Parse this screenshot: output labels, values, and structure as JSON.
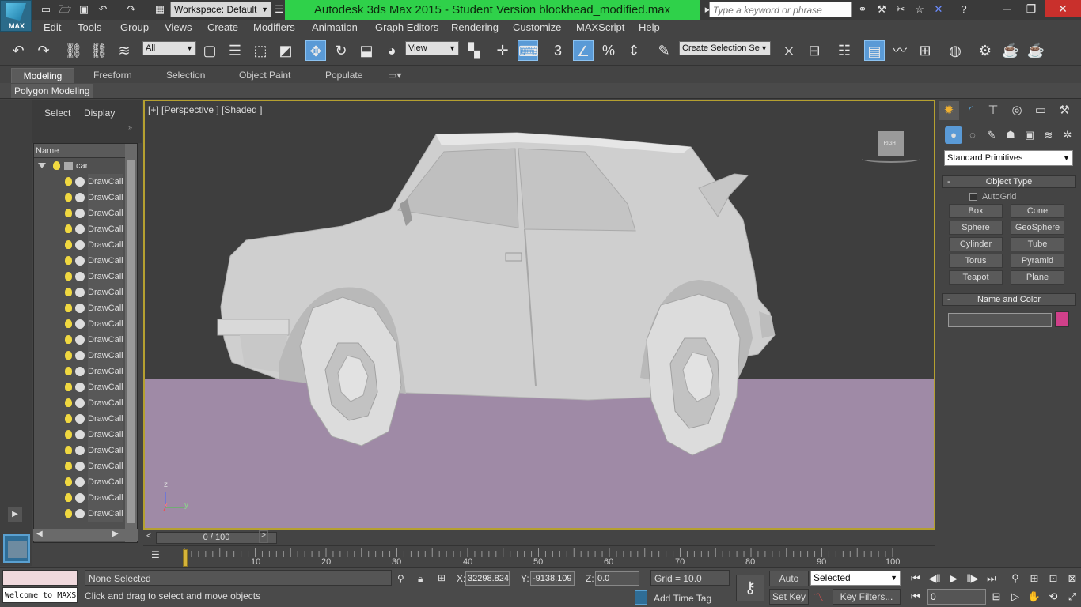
{
  "title_bar": {
    "logo_text": "MAX",
    "workspace": "Workspace: Default",
    "title": "Autodesk 3ds Max  2015   - Student Version     blockhead_modified.max",
    "search_placeholder": "Type a keyword or phrase"
  },
  "menu": [
    "Edit",
    "Tools",
    "Group",
    "Views",
    "Create",
    "Modifiers",
    "Animation",
    "Graph Editors",
    "Rendering",
    "Customize",
    "MAXScript",
    "Help"
  ],
  "toolbar": {
    "filter_select": "All",
    "ref_coord_select": "View",
    "selection_set": "Create Selection Se",
    "snap_number": "3"
  },
  "ribbon": {
    "tabs": [
      "Modeling",
      "Freeform",
      "Selection",
      "Object Paint",
      "Populate"
    ],
    "active_tab": "Modeling",
    "panel_label": "Polygon Modeling"
  },
  "scene_explorer": {
    "tabs": [
      "Select",
      "Display"
    ],
    "column_header": "Name",
    "root_item": "car",
    "items": [
      "DrawCall",
      "DrawCall",
      "DrawCall",
      "DrawCall",
      "DrawCall",
      "DrawCall",
      "DrawCall",
      "DrawCall",
      "DrawCall",
      "DrawCall",
      "DrawCall",
      "DrawCall",
      "DrawCall",
      "DrawCall",
      "DrawCall",
      "DrawCall",
      "DrawCall",
      "DrawCall",
      "DrawCall",
      "DrawCall",
      "DrawCall",
      "DrawCall"
    ]
  },
  "viewport": {
    "label": "[+] [Perspective ] [Shaded ]",
    "viewcube_face": "RIGHT",
    "axis_z": "z",
    "axis_x": "x",
    "axis_y": "y"
  },
  "command_panel": {
    "primitive_type": "Standard Primitives",
    "object_type_header": "Object Type",
    "autogrid": "AutoGrid",
    "buttons": [
      "Box",
      "Cone",
      "Sphere",
      "GeoSphere",
      "Cylinder",
      "Tube",
      "Torus",
      "Pyramid",
      "Teapot",
      "Plane"
    ],
    "name_color_header": "Name and Color",
    "color": "#d0408a"
  },
  "timeline": {
    "slider_label": "0 / 100",
    "ticks": [
      "10",
      "20",
      "30",
      "40",
      "50",
      "60",
      "70",
      "80",
      "90",
      "100"
    ]
  },
  "status": {
    "listener": "Welcome to MAXScript.",
    "selection": "None Selected",
    "prompt": "Click and drag to select and move objects",
    "x_label": "X:",
    "x_value": "32298.824",
    "y_label": "Y:",
    "y_value": "-9138.109",
    "z_label": "Z:",
    "z_value": "0.0",
    "grid": "Grid = 10.0",
    "add_time_tag": "Add Time Tag",
    "auto_key": "Auto Key",
    "set_key": "Set Key",
    "key_mode": "Selected",
    "key_filters": "Key Filters...",
    "frame": "0"
  }
}
